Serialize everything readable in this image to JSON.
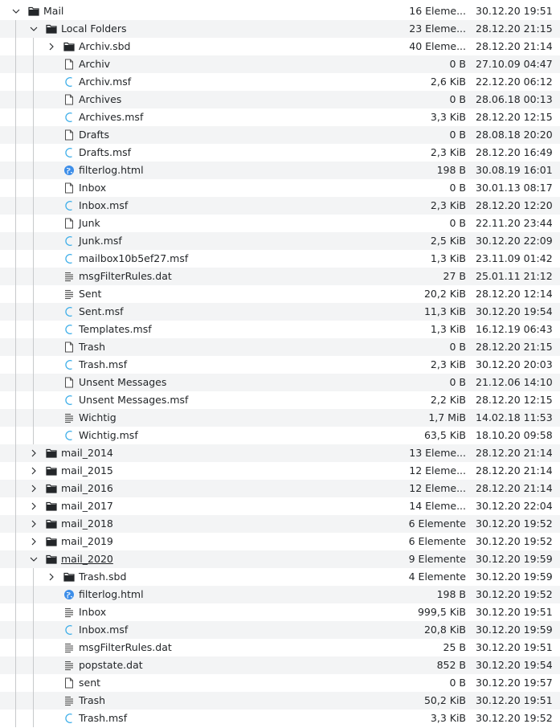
{
  "rows": [
    {
      "depth": 0,
      "expander": "expanded",
      "icon": "folder-icon",
      "name": "Mail",
      "size": "16 Eleme...",
      "date": "30.12.20 19:51"
    },
    {
      "depth": 1,
      "expander": "expanded",
      "icon": "folder-icon",
      "name": "Local Folders",
      "size": "23 Eleme...",
      "date": "28.12.20 21:15"
    },
    {
      "depth": 2,
      "expander": "collapsed",
      "icon": "folder-icon",
      "name": "Archiv.sbd",
      "size": "40 Eleme...",
      "date": "28.12.20 21:14"
    },
    {
      "depth": 2,
      "expander": "none",
      "icon": "file-icon",
      "name": "Archiv",
      "size": "0 B",
      "date": "27.10.09 04:47"
    },
    {
      "depth": 2,
      "expander": "none",
      "icon": "msf-icon",
      "name": "Archiv.msf",
      "size": "2,6 KiB",
      "date": "22.12.20 06:12"
    },
    {
      "depth": 2,
      "expander": "none",
      "icon": "file-icon",
      "name": "Archives",
      "size": "0 B",
      "date": "28.06.18 00:13"
    },
    {
      "depth": 2,
      "expander": "none",
      "icon": "msf-icon",
      "name": "Archives.msf",
      "size": "3,3 KiB",
      "date": "28.12.20 12:15"
    },
    {
      "depth": 2,
      "expander": "none",
      "icon": "file-icon",
      "name": "Drafts",
      "size": "0 B",
      "date": "28.08.18 20:20"
    },
    {
      "depth": 2,
      "expander": "none",
      "icon": "msf-icon",
      "name": "Drafts.msf",
      "size": "2,3 KiB",
      "date": "28.12.20 16:49"
    },
    {
      "depth": 2,
      "expander": "none",
      "icon": "html-icon",
      "name": "filterlog.html",
      "size": "198 B",
      "date": "30.08.19 16:01"
    },
    {
      "depth": 2,
      "expander": "none",
      "icon": "file-icon",
      "name": "Inbox",
      "size": "0 B",
      "date": "30.01.13 08:17"
    },
    {
      "depth": 2,
      "expander": "none",
      "icon": "msf-icon",
      "name": "Inbox.msf",
      "size": "2,3 KiB",
      "date": "28.12.20 12:20"
    },
    {
      "depth": 2,
      "expander": "none",
      "icon": "file-icon",
      "name": "Junk",
      "size": "0 B",
      "date": "22.11.20 23:44"
    },
    {
      "depth": 2,
      "expander": "none",
      "icon": "msf-icon",
      "name": "Junk.msf",
      "size": "2,5 KiB",
      "date": "30.12.20 22:09"
    },
    {
      "depth": 2,
      "expander": "none",
      "icon": "msf-icon",
      "name": "mailbox10b5ef27.msf",
      "size": "1,3 KiB",
      "date": "23.11.09 01:42"
    },
    {
      "depth": 2,
      "expander": "none",
      "icon": "text-icon",
      "name": "msgFilterRules.dat",
      "size": "27 B",
      "date": "25.01.11 21:12"
    },
    {
      "depth": 2,
      "expander": "none",
      "icon": "text-icon",
      "name": "Sent",
      "size": "20,2 KiB",
      "date": "28.12.20 12:14"
    },
    {
      "depth": 2,
      "expander": "none",
      "icon": "msf-icon",
      "name": "Sent.msf",
      "size": "11,3 KiB",
      "date": "30.12.20 19:54"
    },
    {
      "depth": 2,
      "expander": "none",
      "icon": "msf-icon",
      "name": "Templates.msf",
      "size": "1,3 KiB",
      "date": "16.12.19 06:43"
    },
    {
      "depth": 2,
      "expander": "none",
      "icon": "file-icon",
      "name": "Trash",
      "size": "0 B",
      "date": "28.12.20 21:15"
    },
    {
      "depth": 2,
      "expander": "none",
      "icon": "msf-icon",
      "name": "Trash.msf",
      "size": "2,3 KiB",
      "date": "30.12.20 20:03"
    },
    {
      "depth": 2,
      "expander": "none",
      "icon": "file-icon",
      "name": "Unsent Messages",
      "size": "0 B",
      "date": "21.12.06 14:10"
    },
    {
      "depth": 2,
      "expander": "none",
      "icon": "msf-icon",
      "name": "Unsent Messages.msf",
      "size": "2,2 KiB",
      "date": "28.12.20 12:15"
    },
    {
      "depth": 2,
      "expander": "none",
      "icon": "text-icon",
      "name": "Wichtig",
      "size": "1,7 MiB",
      "date": "14.02.18 11:53"
    },
    {
      "depth": 2,
      "expander": "none",
      "icon": "msf-icon",
      "name": "Wichtig.msf",
      "size": "63,5 KiB",
      "date": "18.10.20 09:58"
    },
    {
      "depth": 1,
      "expander": "collapsed",
      "icon": "folder-icon",
      "name": "mail_2014",
      "size": "13 Eleme...",
      "date": "28.12.20 21:14"
    },
    {
      "depth": 1,
      "expander": "collapsed",
      "icon": "folder-icon",
      "name": "mail_2015",
      "size": "12 Eleme...",
      "date": "28.12.20 21:14"
    },
    {
      "depth": 1,
      "expander": "collapsed",
      "icon": "folder-icon",
      "name": "mail_2016",
      "size": "12 Eleme...",
      "date": "28.12.20 21:14"
    },
    {
      "depth": 1,
      "expander": "collapsed",
      "icon": "folder-icon",
      "name": "mail_2017",
      "size": "14 Eleme...",
      "date": "30.12.20 22:04"
    },
    {
      "depth": 1,
      "expander": "collapsed",
      "icon": "folder-icon",
      "name": "mail_2018",
      "size": "6 Elemente",
      "date": "30.12.20 19:52"
    },
    {
      "depth": 1,
      "expander": "collapsed",
      "icon": "folder-icon",
      "name": "mail_2019",
      "size": "6 Elemente",
      "date": "30.12.20 19:52"
    },
    {
      "depth": 1,
      "expander": "expanded",
      "icon": "folder-icon",
      "name": "mail_2020",
      "size": "9 Elemente",
      "date": "30.12.20 19:59",
      "underline": true
    },
    {
      "depth": 2,
      "expander": "collapsed",
      "icon": "folder-icon",
      "name": "Trash.sbd",
      "size": "4 Elemente",
      "date": "30.12.20 19:59"
    },
    {
      "depth": 2,
      "expander": "none",
      "icon": "html-icon",
      "name": "filterlog.html",
      "size": "198 B",
      "date": "30.12.20 19:52"
    },
    {
      "depth": 2,
      "expander": "none",
      "icon": "text-icon",
      "name": "Inbox",
      "size": "999,5 KiB",
      "date": "30.12.20 19:51"
    },
    {
      "depth": 2,
      "expander": "none",
      "icon": "msf-icon",
      "name": "Inbox.msf",
      "size": "20,8 KiB",
      "date": "30.12.20 19:59"
    },
    {
      "depth": 2,
      "expander": "none",
      "icon": "text-icon",
      "name": "msgFilterRules.dat",
      "size": "25 B",
      "date": "30.12.20 19:51"
    },
    {
      "depth": 2,
      "expander": "none",
      "icon": "text-icon",
      "name": "popstate.dat",
      "size": "852 B",
      "date": "30.12.20 19:54"
    },
    {
      "depth": 2,
      "expander": "none",
      "icon": "file-icon",
      "name": "sent",
      "size": "0 B",
      "date": "30.12.20 19:57"
    },
    {
      "depth": 2,
      "expander": "none",
      "icon": "text-icon",
      "name": "Trash",
      "size": "50,2 KiB",
      "date": "30.12.20 19:51"
    },
    {
      "depth": 2,
      "expander": "none",
      "icon": "msf-icon",
      "name": "Trash.msf",
      "size": "3,3 KiB",
      "date": "30.12.20 19:52"
    }
  ],
  "colors": {
    "alt_row": "#f3f4f5",
    "text": "#232629",
    "msf_icon": "#3daee9",
    "html_icon": "#3d8ee9",
    "folder_icon": "#232629"
  }
}
